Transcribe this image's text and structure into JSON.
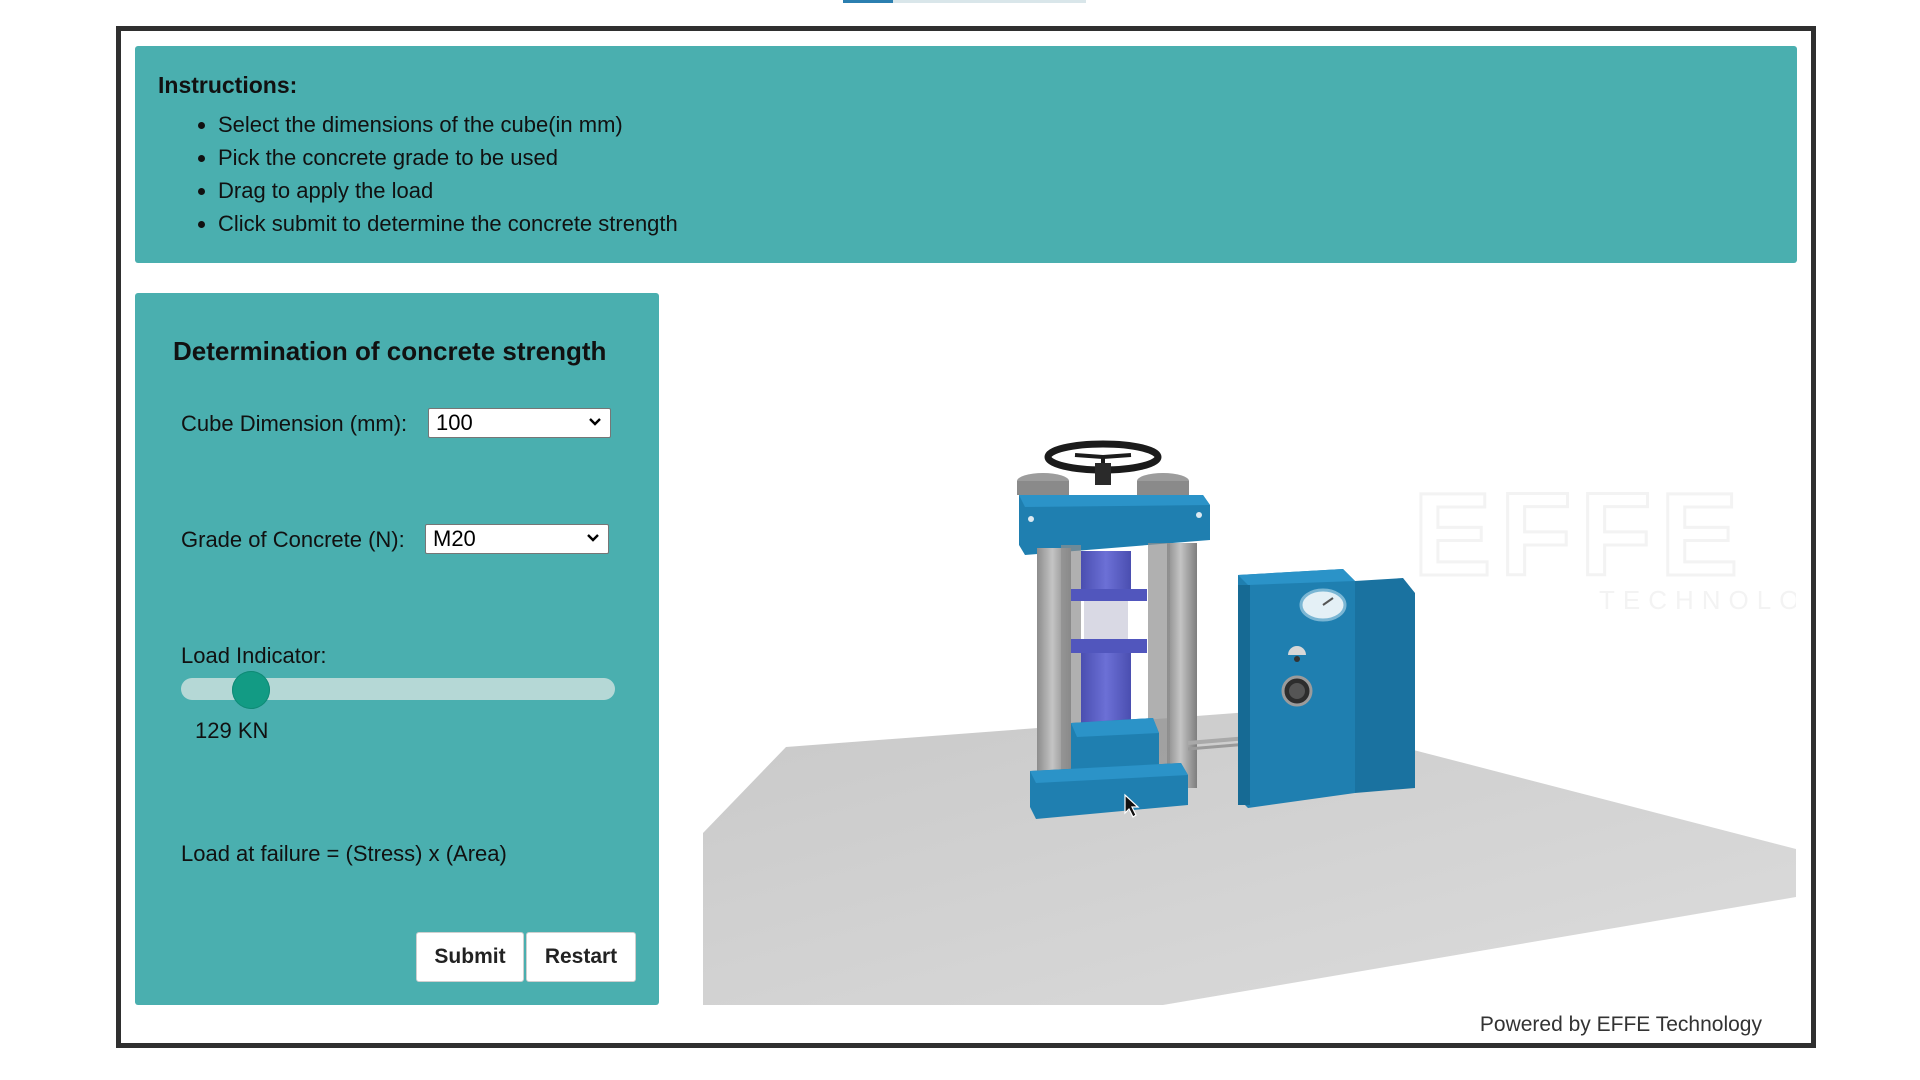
{
  "instructions": {
    "title": "Instructions:",
    "items": [
      "Select the dimensions of the cube(in mm)",
      "Pick the concrete grade to be used",
      "Drag to apply the load",
      "Click submit to determine the concrete strength"
    ]
  },
  "panel": {
    "title": "Determination of concrete strength",
    "cube_label": "Cube Dimension (mm):",
    "cube_value": "100",
    "grade_label": "Grade of Concrete (N):",
    "grade_value": "M20",
    "load_label": "Load Indicator:",
    "load_value": "129 KN",
    "load_fraction": 0.13,
    "formula": "Load at failure = (Stress) x (Area)",
    "submit_label": "Submit",
    "restart_label": "Restart"
  },
  "scene": {
    "watermark_main": "EFFE",
    "watermark_sub": "TECHNOLOGY"
  },
  "footer": {
    "text": "Powered by EFFE Technology"
  },
  "colors": {
    "panel_bg": "#4aafaf",
    "slider_thumb": "#129b84",
    "machine_blue": "#1f7fb0",
    "piston_purple": "#5b5fc7",
    "floor": "#cfcfcf"
  }
}
